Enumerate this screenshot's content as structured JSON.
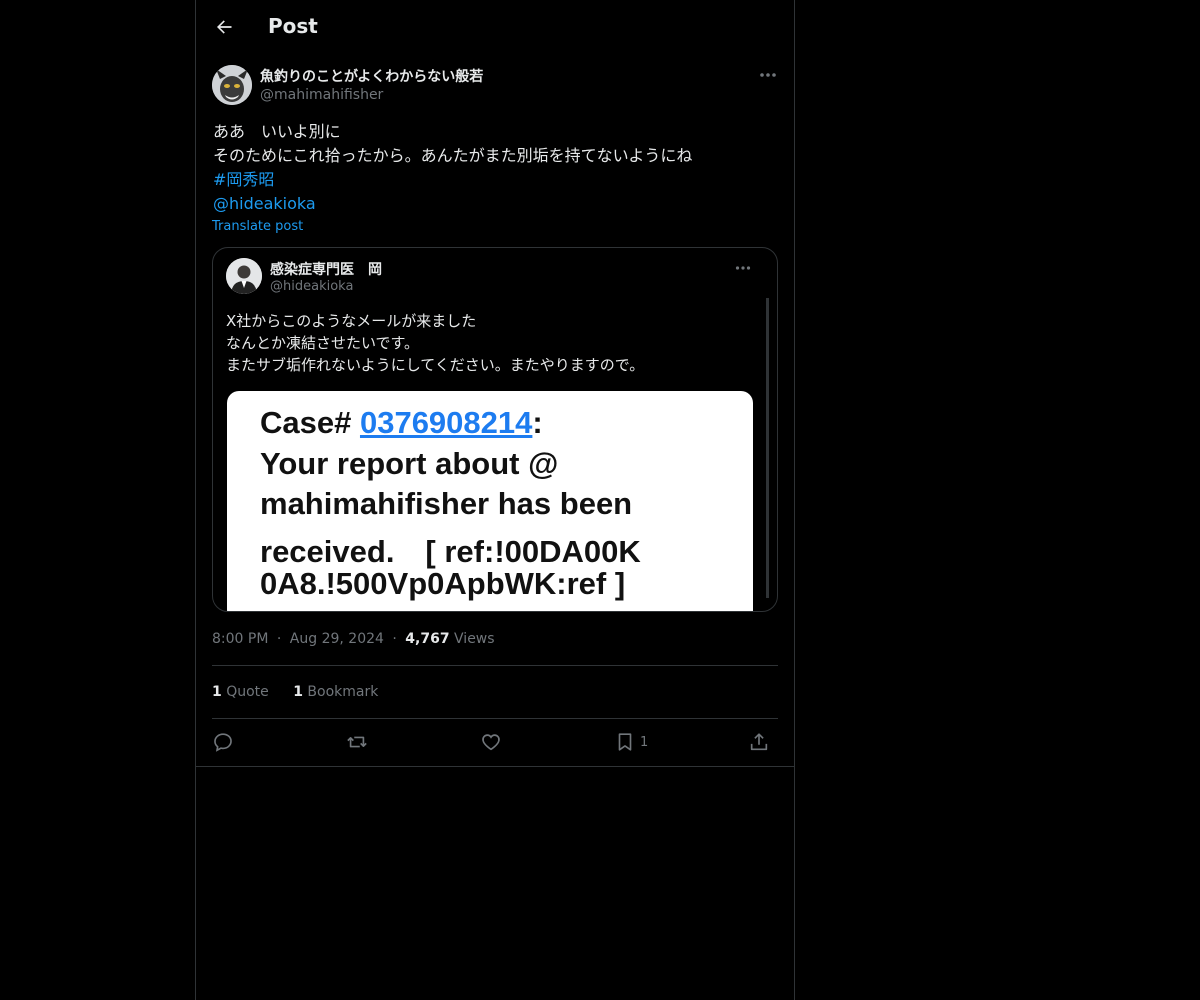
{
  "header": {
    "title": "Post"
  },
  "post": {
    "author_name": "魚釣りのことがよくわからない般若",
    "author_handle": "@mahimahifisher",
    "lines": [
      "ああ　いいよ別に",
      "そのためにこれ拾ったから。あんたがまた別垢を持てないようにね"
    ],
    "hashtag": "#岡秀昭",
    "mention": "@hideakioka",
    "translate_label": "Translate post"
  },
  "quote": {
    "author_name": "感染症専門医　岡",
    "author_handle": "@hideakioka",
    "lines": [
      "X社からこのようなメールが来ました",
      "なんとか凍結させたいです。",
      "またサブ垢作れないようにしてください。またやりますので。"
    ],
    "image_text": {
      "case_prefix": "Case# ",
      "case_number": "0376908214",
      "case_suffix": ":",
      "line2": "Your report about @",
      "line3": "mahimahifisher has been",
      "line4": "received.　[ ref:!00DA00K",
      "line5": "0A8.!500Vp0ApbWK:ref ]"
    }
  },
  "meta": {
    "time": "8:00 PM",
    "sep1": "·",
    "date": "Aug 29, 2024",
    "sep2": "·",
    "views_count": "4,767",
    "views_label": "Views"
  },
  "stats": {
    "quotes_count": "1",
    "quotes_label": "Quote",
    "bookmarks_count": "1",
    "bookmarks_label": "Bookmark"
  },
  "actions": {
    "bookmark_count": "1"
  },
  "colors": {
    "background": "#000000",
    "text": "#e7e9ea",
    "muted": "#71767b",
    "link": "#1d9bf0",
    "border": "#2f3336"
  }
}
